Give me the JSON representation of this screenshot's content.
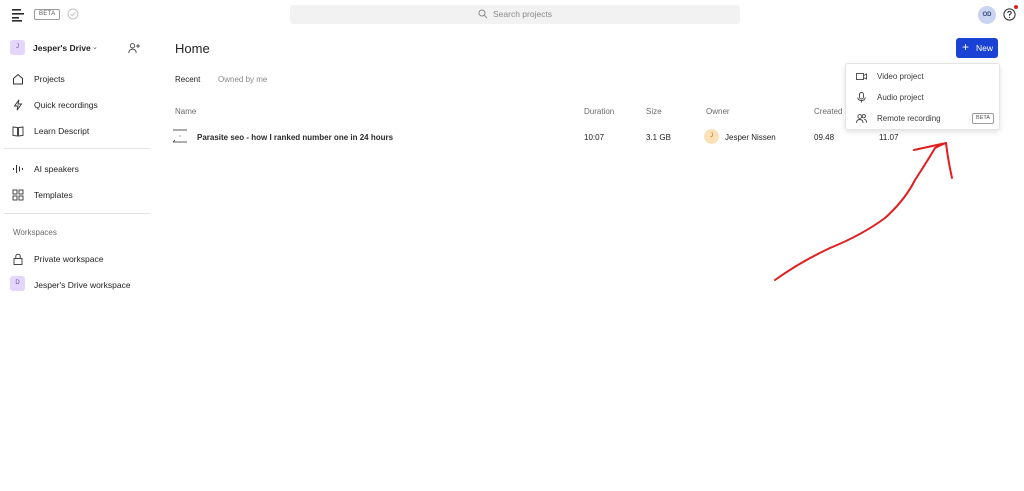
{
  "topbar": {
    "beta_label": "BETA",
    "search_placeholder": "Search projects",
    "avatar_initials": "OD"
  },
  "sidebar": {
    "drive": {
      "badge": "J",
      "name": "Jesper's Drive"
    },
    "nav": [
      {
        "label": "Projects",
        "icon": "home-icon"
      },
      {
        "label": "Quick recordings",
        "icon": "lightning-icon"
      },
      {
        "label": "Learn Descript",
        "icon": "book-icon"
      },
      {
        "label": "AI speakers",
        "icon": "waveform-icon"
      },
      {
        "label": "Templates",
        "icon": "grid-icon"
      }
    ],
    "workspaces_label": "Workspaces",
    "workspaces": [
      {
        "label": "Private workspace",
        "icon": "lock-icon"
      },
      {
        "label": "Jesper's Drive workspace",
        "badge": "D"
      }
    ]
  },
  "main": {
    "title": "Home",
    "tabs": [
      "Recent",
      "Owned by me"
    ],
    "columns": [
      "Name",
      "Duration",
      "Size",
      "Owner",
      "Created"
    ],
    "rows": [
      {
        "name": "Parasite seo - how I ranked number one in 24 hours",
        "duration": "10:07",
        "size": "3.1 GB",
        "owner_initial": "J",
        "owner": "Jesper Nissen",
        "created": "09.48",
        "modified": "11.07"
      }
    ]
  },
  "new_menu": {
    "button_label": "New",
    "items": [
      {
        "label": "Video project",
        "icon": "video-camera-icon"
      },
      {
        "label": "Audio project",
        "icon": "microphone-icon"
      },
      {
        "label": "Remote recording",
        "icon": "people-icon",
        "badge": "BETA"
      }
    ]
  },
  "colors": {
    "accent": "#1a43d6",
    "annotation": "#e02020",
    "badge_purple": "#e3d5fb",
    "owner_orange": "#fbe1b8"
  }
}
